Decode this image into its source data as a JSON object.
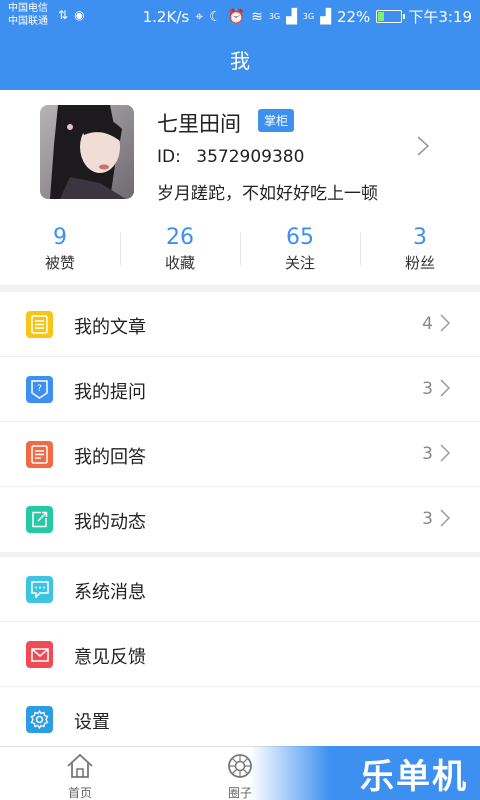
{
  "status_bar": {
    "carrier_1": "中国电信",
    "carrier_2": "中国联通",
    "speed": "1.2K/s",
    "network_1": "3G",
    "network_2": "3G",
    "battery": "22%",
    "battery_level": 0.22,
    "time": "下午3:19"
  },
  "header": {
    "title": "我"
  },
  "profile": {
    "name": "七里田间",
    "badge": "掌柜",
    "id_label": "ID:",
    "id_value": "3572909380",
    "motto": "岁月蹉跎，不如好好吃上一顿"
  },
  "stats": [
    {
      "value": "9",
      "label": "被赞"
    },
    {
      "value": "26",
      "label": "收藏"
    },
    {
      "value": "65",
      "label": "关注"
    },
    {
      "value": "3",
      "label": "粉丝"
    }
  ],
  "menu_primary": [
    {
      "label": "我的文章",
      "count": "4",
      "icon": "article-icon",
      "color": "#f5c518"
    },
    {
      "label": "我的提问",
      "count": "3",
      "icon": "question-icon",
      "color": "#3d8ff0"
    },
    {
      "label": "我的回答",
      "count": "3",
      "icon": "answer-icon",
      "color": "#f06a45"
    },
    {
      "label": "我的动态",
      "count": "3",
      "icon": "activity-icon",
      "color": "#26c9a3"
    }
  ],
  "menu_secondary": [
    {
      "label": "系统消息",
      "icon": "message-icon",
      "color": "#3dc4e0"
    },
    {
      "label": "意见反馈",
      "icon": "mail-icon",
      "color": "#ee4b55"
    },
    {
      "label": "设置",
      "icon": "settings-icon",
      "color": "#2a9ee0"
    }
  ],
  "bottom_nav": [
    {
      "label": "首页",
      "icon": "home-icon"
    },
    {
      "label": "圈子",
      "icon": "circle-icon"
    }
  ],
  "watermark": "乐单机",
  "colors": {
    "primary": "#3d8ff0"
  }
}
